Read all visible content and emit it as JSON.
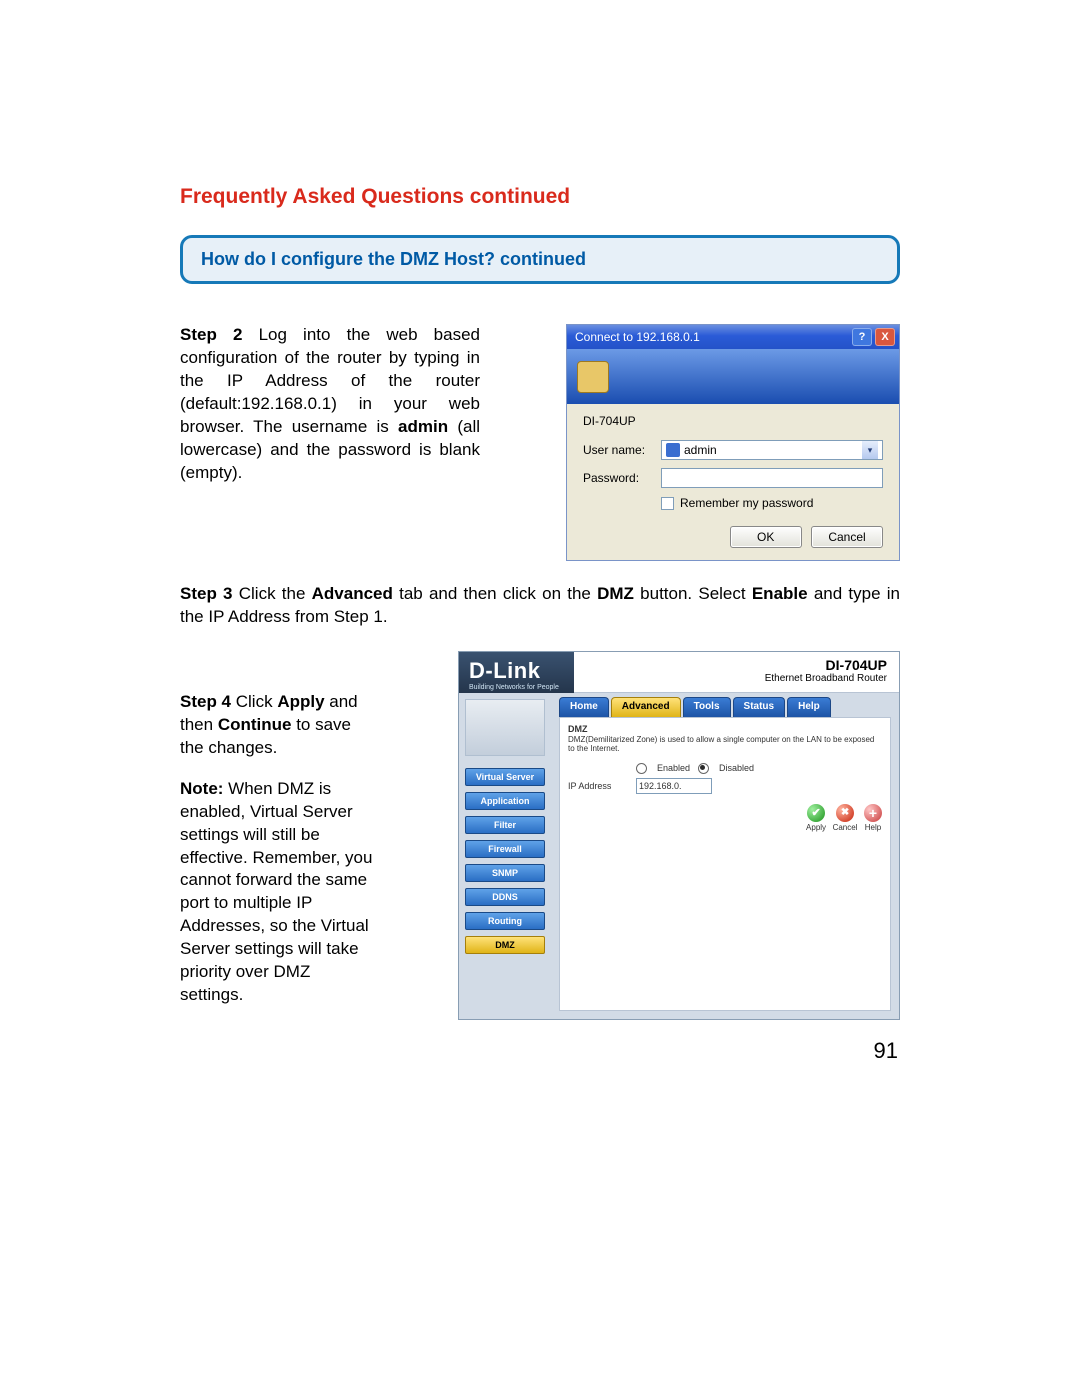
{
  "heading": "Frequently Asked Questions continued",
  "question": "How do I configure the DMZ Host? continued",
  "step2": {
    "label": "Step 2",
    "text_1": " Log into the web based configuration of the router by typing in the IP Address of the router (default:192.168.0.1) in your web browser. The username is ",
    "admin": "admin",
    "text_2": " (all lowercase) and the password is blank (empty)."
  },
  "auth_dialog": {
    "title": "Connect to 192.168.0.1",
    "help_btn": "?",
    "close_btn": "X",
    "realm": "DI-704UP",
    "username_label": "User name:",
    "username_value": "admin",
    "password_label": "Password:",
    "remember_label": "Remember my password",
    "ok": "OK",
    "cancel": "Cancel"
  },
  "step3": {
    "label": "Step 3",
    "text_a": " Click the ",
    "adv": "Advanced",
    "text_b": " tab and then click on the ",
    "dmz": "DMZ",
    "text_c": " button. Select ",
    "enable": "Enable",
    "text_d": " and type in the IP Address from Step 1."
  },
  "step4": {
    "label": "Step 4",
    "text_a": " Click ",
    "apply": "Apply",
    "text_b": " and then ",
    "cont": "Continue",
    "text_c": " to save the changes.",
    "note_label": "Note:",
    "note_text": " When DMZ is enabled, Virtual Server settings will still be effective. Remember, you cannot forward the same port to multiple IP Addresses, so the Virtual Server settings will take priority over DMZ settings."
  },
  "router": {
    "brand": "D-Link",
    "tagline": "Building Networks for People",
    "model": "DI-704UP",
    "model_desc": "Ethernet Broadband Router",
    "tabs": [
      "Home",
      "Advanced",
      "Tools",
      "Status",
      "Help"
    ],
    "active_tab": 1,
    "side_buttons": [
      "Virtual Server",
      "Application",
      "Filter",
      "Firewall",
      "SNMP",
      "DDNS",
      "Routing",
      "DMZ"
    ],
    "active_side": 7,
    "panel": {
      "title": "DMZ",
      "desc": "DMZ(Demilitarized Zone) is used to allow a single computer on the LAN to be exposed to the Internet.",
      "enabled_label": "Enabled",
      "disabled_label": "Disabled",
      "ip_label": "IP Address",
      "ip_value": "192.168.0.",
      "apply": "Apply",
      "cancel": "Cancel",
      "help": "Help"
    }
  },
  "page_number": "91"
}
